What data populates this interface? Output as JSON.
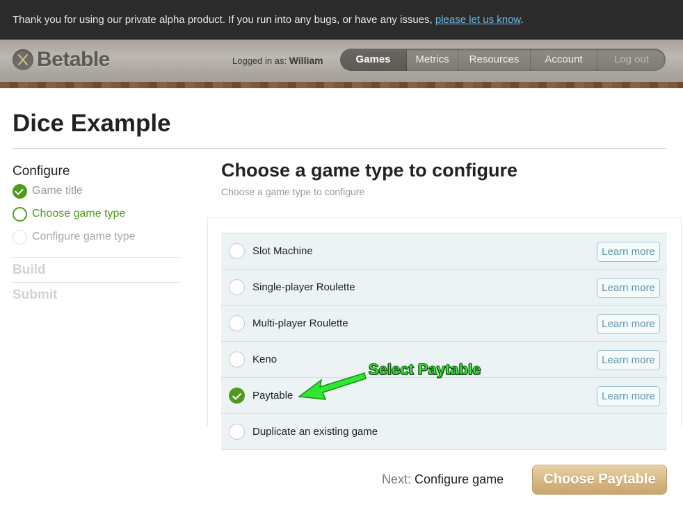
{
  "banner": {
    "text": "Thank you for using our private alpha product. If you run into any bugs, or have any issues, ",
    "link": "please let us know",
    "suffix": "."
  },
  "header": {
    "logo": "Betable",
    "logged_in_label": "Logged in as:",
    "user": "William",
    "nav": [
      {
        "label": "Games",
        "state": "active"
      },
      {
        "label": "Metrics",
        "state": "normal"
      },
      {
        "label": "Resources",
        "state": "normal"
      },
      {
        "label": "Account",
        "state": "normal"
      },
      {
        "label": "Log out",
        "state": "muted"
      }
    ]
  },
  "page": {
    "title": "Dice Example"
  },
  "sidebar": {
    "heading": "Configure",
    "steps": [
      {
        "label": "Game title",
        "status": "done",
        "color": "#999999"
      },
      {
        "label": "Choose game type",
        "status": "current",
        "color": "#4f9a1c"
      },
      {
        "label": "Configure game type",
        "status": "todo",
        "color": "#aaaaaa"
      }
    ],
    "build": "Build",
    "submit": "Submit"
  },
  "main": {
    "title": "Choose a game type to configure",
    "subtitle": "Choose a game type to configure",
    "options": [
      {
        "label": "Slot Machine",
        "checked": false,
        "learn_more": "Learn more"
      },
      {
        "label": "Single-player Roulette",
        "checked": false,
        "learn_more": "Learn more"
      },
      {
        "label": "Multi-player Roulette",
        "checked": false,
        "learn_more": "Learn more"
      },
      {
        "label": "Keno",
        "checked": false,
        "learn_more": "Learn more"
      },
      {
        "label": "Paytable",
        "checked": true,
        "learn_more": "Learn more"
      },
      {
        "label": "Duplicate an existing game",
        "checked": false,
        "learn_more": ""
      }
    ]
  },
  "annotation": {
    "text": "Select Paytable",
    "color": "#3cf53c"
  },
  "footer": {
    "next_label": "Next:",
    "next_value": "Configure game",
    "cta": "Choose Paytable"
  },
  "colors": {
    "accent_green": "#4f9a1c",
    "link_blue": "#6fb7e6",
    "cta_gold": "#c9a46a"
  }
}
